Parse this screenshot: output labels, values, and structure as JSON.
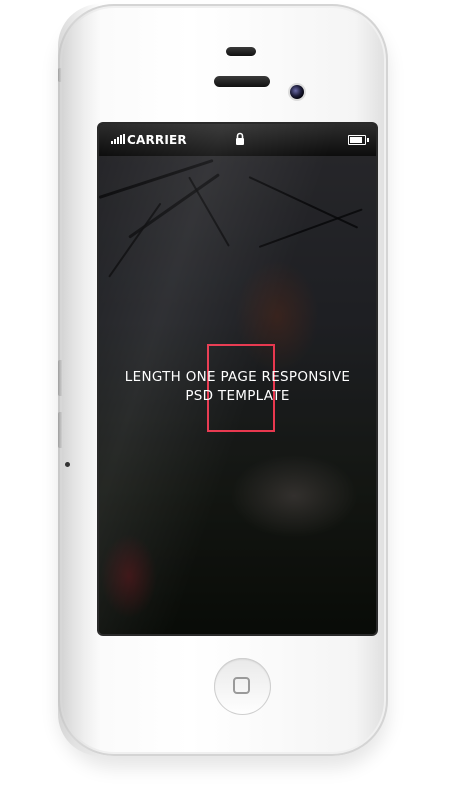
{
  "status_bar": {
    "carrier": "CARRIER",
    "signal_icon": "signal-bars-icon",
    "lock_icon": "lock-icon",
    "battery_icon": "battery-icon"
  },
  "screen": {
    "headline_line1": "LENGTH ONE PAGE RESPONSIVE",
    "headline_line2": "PSD TEMPLATE",
    "frame_color": "#e8384f"
  },
  "device": {
    "home_icon": "home-button-icon",
    "camera_icon": "front-camera-icon",
    "speaker_icon": "speaker-grille-icon"
  }
}
